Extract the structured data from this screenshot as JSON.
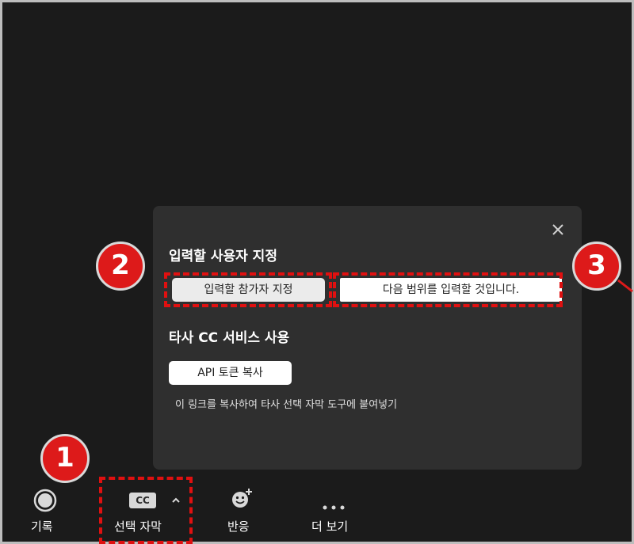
{
  "popup": {
    "section1_title": "입력할 사용자 지정",
    "assign_button_label": "입력할 참가자 지정",
    "assign_info_text": "다음 범위를 입력할 것입니다.",
    "section2_title": "타사 CC 서비스 사용",
    "copy_token_button_label": "API 토큰 복사",
    "hint_text": "이 링크를 복사하여 타사 선택 자막 도구에 붙여넣기",
    "close_icon": "close-icon"
  },
  "toolbar": {
    "record_label": "기록",
    "record_icon": "record-icon",
    "captions_label": "선택 자막",
    "cc_badge_text": "CC",
    "captions_caret_icon": "chevron-up-icon",
    "reactions_label": "반응",
    "reactions_icon": "emoji-add-icon",
    "more_label": "더 보기",
    "more_icon": "ellipsis-icon"
  },
  "annotations": {
    "marker_1": "1",
    "marker_2": "2",
    "marker_3": "3",
    "highlight_color": "#e01010"
  },
  "colors": {
    "background": "#1b1b1b",
    "popup_background": "#2f2f2f",
    "marker_red": "#dd1a1a"
  }
}
